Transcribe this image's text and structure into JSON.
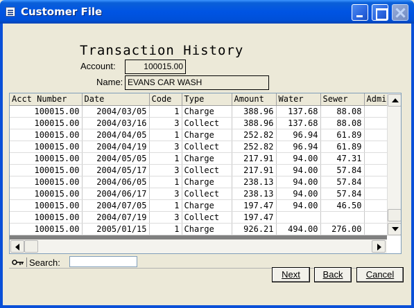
{
  "window": {
    "title": "Customer File"
  },
  "heading": "Transaction History",
  "account": {
    "label": "Account:",
    "value": "100015.00"
  },
  "name": {
    "label": "Name:",
    "value": "EVANS CAR WASH"
  },
  "grid": {
    "columns": [
      "Acct Number",
      "Date",
      "Code",
      "Type",
      "Amount",
      "Water",
      "Sewer",
      "Admi"
    ],
    "rows": [
      [
        "100015.00",
        "2004/03/05",
        "1",
        "Charge",
        "388.96",
        "137.68",
        "88.08",
        ""
      ],
      [
        "100015.00",
        "2004/03/16",
        "3",
        "Collect",
        "388.96",
        "137.68",
        "88.08",
        ""
      ],
      [
        "100015.00",
        "2004/04/05",
        "1",
        "Charge",
        "252.82",
        "96.94",
        "61.89",
        ""
      ],
      [
        "100015.00",
        "2004/04/19",
        "3",
        "Collect",
        "252.82",
        "96.94",
        "61.89",
        ""
      ],
      [
        "100015.00",
        "2004/05/05",
        "1",
        "Charge",
        "217.91",
        "94.00",
        "47.31",
        ""
      ],
      [
        "100015.00",
        "2004/05/17",
        "3",
        "Collect",
        "217.91",
        "94.00",
        "57.84",
        ""
      ],
      [
        "100015.00",
        "2004/06/05",
        "1",
        "Charge",
        "238.13",
        "94.00",
        "57.84",
        ""
      ],
      [
        "100015.00",
        "2004/06/17",
        "3",
        "Collect",
        "238.13",
        "94.00",
        "57.84",
        ""
      ],
      [
        "100015.00",
        "2004/07/05",
        "1",
        "Charge",
        "197.47",
        "94.00",
        "46.50",
        ""
      ],
      [
        "100015.00",
        "2004/07/19",
        "3",
        "Collect",
        "197.47",
        "",
        "",
        ""
      ],
      [
        "100015.00",
        "2005/01/15",
        "1",
        "Charge",
        "926.21",
        "494.00",
        "276.00",
        ""
      ]
    ]
  },
  "search": {
    "label": "Search:",
    "value": ""
  },
  "buttons": {
    "next": "Next",
    "back": "Back",
    "cancel": "Cancel"
  },
  "icons": {
    "search": "key-icon"
  }
}
